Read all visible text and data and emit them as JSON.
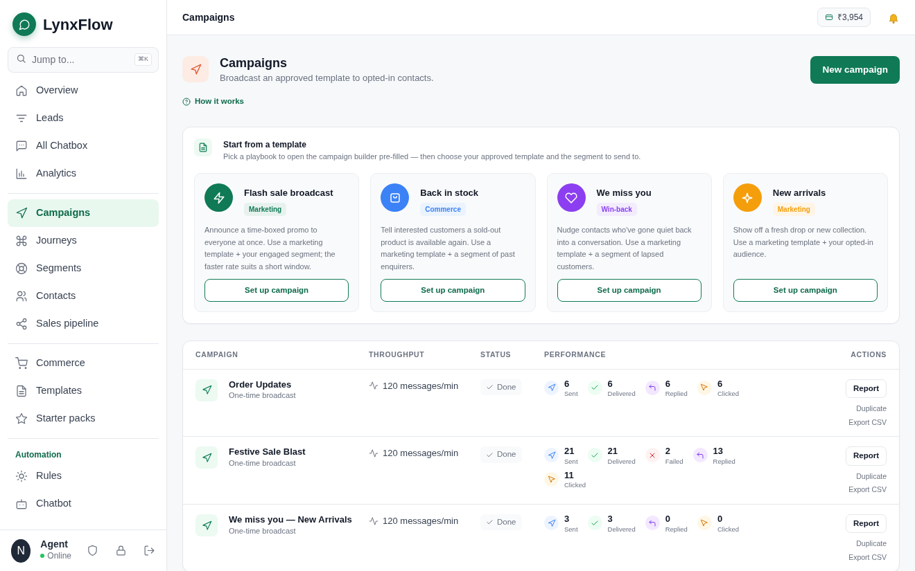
{
  "brand": {
    "name": "LynxFlow"
  },
  "search": {
    "placeholder": "Jump to...",
    "shortcut": "⌘K"
  },
  "sidebar": {
    "groups": [
      {
        "items": [
          {
            "label": "Overview",
            "selected": false
          },
          {
            "label": "Leads",
            "selected": false
          },
          {
            "label": "All Chatbox",
            "selected": false
          },
          {
            "label": "Analytics",
            "selected": false
          }
        ]
      },
      {
        "items": [
          {
            "label": "Campaigns",
            "selected": true
          },
          {
            "label": "Journeys",
            "selected": false
          },
          {
            "label": "Segments",
            "selected": false
          },
          {
            "label": "Contacts",
            "selected": false
          },
          {
            "label": "Sales pipeline",
            "selected": false
          }
        ]
      },
      {
        "items": [
          {
            "label": "Commerce",
            "selected": false
          },
          {
            "label": "Templates",
            "selected": false
          },
          {
            "label": "Starter packs",
            "selected": false
          }
        ]
      },
      {
        "title": "Automation",
        "items": [
          {
            "label": "Rules",
            "selected": false
          },
          {
            "label": "Chatbot",
            "selected": false
          }
        ]
      }
    ]
  },
  "user": {
    "initial": "N",
    "name": "Agent",
    "status": "Online",
    "online": true
  },
  "topbar": {
    "title": "Campaigns",
    "balance": "₹3,954"
  },
  "header": {
    "title": "Campaigns",
    "subtitle": "Broadcast an approved template to opted-in contacts.",
    "help_link": "How it works",
    "button": "New campaign"
  },
  "templates": {
    "title": "Start from a template",
    "description": "Pick a playbook to open the campaign builder pre-filled — then choose your approved template and the segment to send to.",
    "cards": [
      {
        "title": "Flash sale broadcast",
        "tag": "Marketing",
        "color": "#0f7a55",
        "description": "Announce a time-boxed promo to everyone at once. Use a marketing template + your engaged segment; the faster rate suits a short window.",
        "button": "Set up campaign"
      },
      {
        "title": "Back in stock",
        "tag": "Commerce",
        "color": "#3b82f6",
        "description": "Tell interested customers a sold-out product is available again. Use a marketing template + a segment of past enquirers.",
        "button": "Set up campaign"
      },
      {
        "title": "We miss you",
        "tag": "Win-back",
        "color": "#8b3ff0",
        "description": "Nudge contacts who've gone quiet back into a conversation. Use a marketing template + a segment of lapsed customers.",
        "button": "Set up campaign"
      },
      {
        "title": "New arrivals",
        "tag": "Marketing",
        "color": "#f59e0b",
        "description": "Show off a fresh drop or new collection. Use a marketing template + your opted-in audience.",
        "button": "Set up campaign"
      }
    ]
  },
  "table": {
    "columns": [
      "CAMPAIGN",
      "THROUGHPUT",
      "STATUS",
      "PERFORMANCE",
      "ACTIONS"
    ],
    "rows": [
      {
        "name": "Order Updates",
        "type": "One-time broadcast",
        "throughput": "120 messages/min",
        "status": "Done",
        "metrics": [
          {
            "kind": "sent",
            "value": "6",
            "label": "Sent"
          },
          {
            "kind": "delivered",
            "value": "6",
            "label": "Delivered"
          },
          {
            "kind": "replied",
            "value": "6",
            "label": "Replied"
          },
          {
            "kind": "clicked",
            "value": "6",
            "label": "Clicked"
          }
        ],
        "actions": [
          "Report",
          "Duplicate",
          "Export CSV"
        ]
      },
      {
        "name": "Festive Sale Blast",
        "type": "One-time broadcast",
        "throughput": "120 messages/min",
        "status": "Done",
        "metrics": [
          {
            "kind": "sent",
            "value": "21",
            "label": "Sent"
          },
          {
            "kind": "delivered",
            "value": "21",
            "label": "Delivered"
          },
          {
            "kind": "failed",
            "value": "2",
            "label": "Failed"
          },
          {
            "kind": "replied",
            "value": "13",
            "label": "Replied"
          },
          {
            "kind": "clicked",
            "value": "11",
            "label": "Clicked"
          }
        ],
        "actions": [
          "Report",
          "Duplicate",
          "Export CSV"
        ]
      },
      {
        "name": "We miss you — New Arrivals",
        "type": "One-time broadcast",
        "throughput": "120 messages/min",
        "status": "Done",
        "metrics": [
          {
            "kind": "sent",
            "value": "3",
            "label": "Sent"
          },
          {
            "kind": "delivered",
            "value": "3",
            "label": "Delivered"
          },
          {
            "kind": "replied",
            "value": "0",
            "label": "Replied"
          },
          {
            "kind": "clicked",
            "value": "0",
            "label": "Clicked"
          }
        ],
        "actions": [
          "Report",
          "Duplicate",
          "Export CSV"
        ]
      }
    ]
  }
}
